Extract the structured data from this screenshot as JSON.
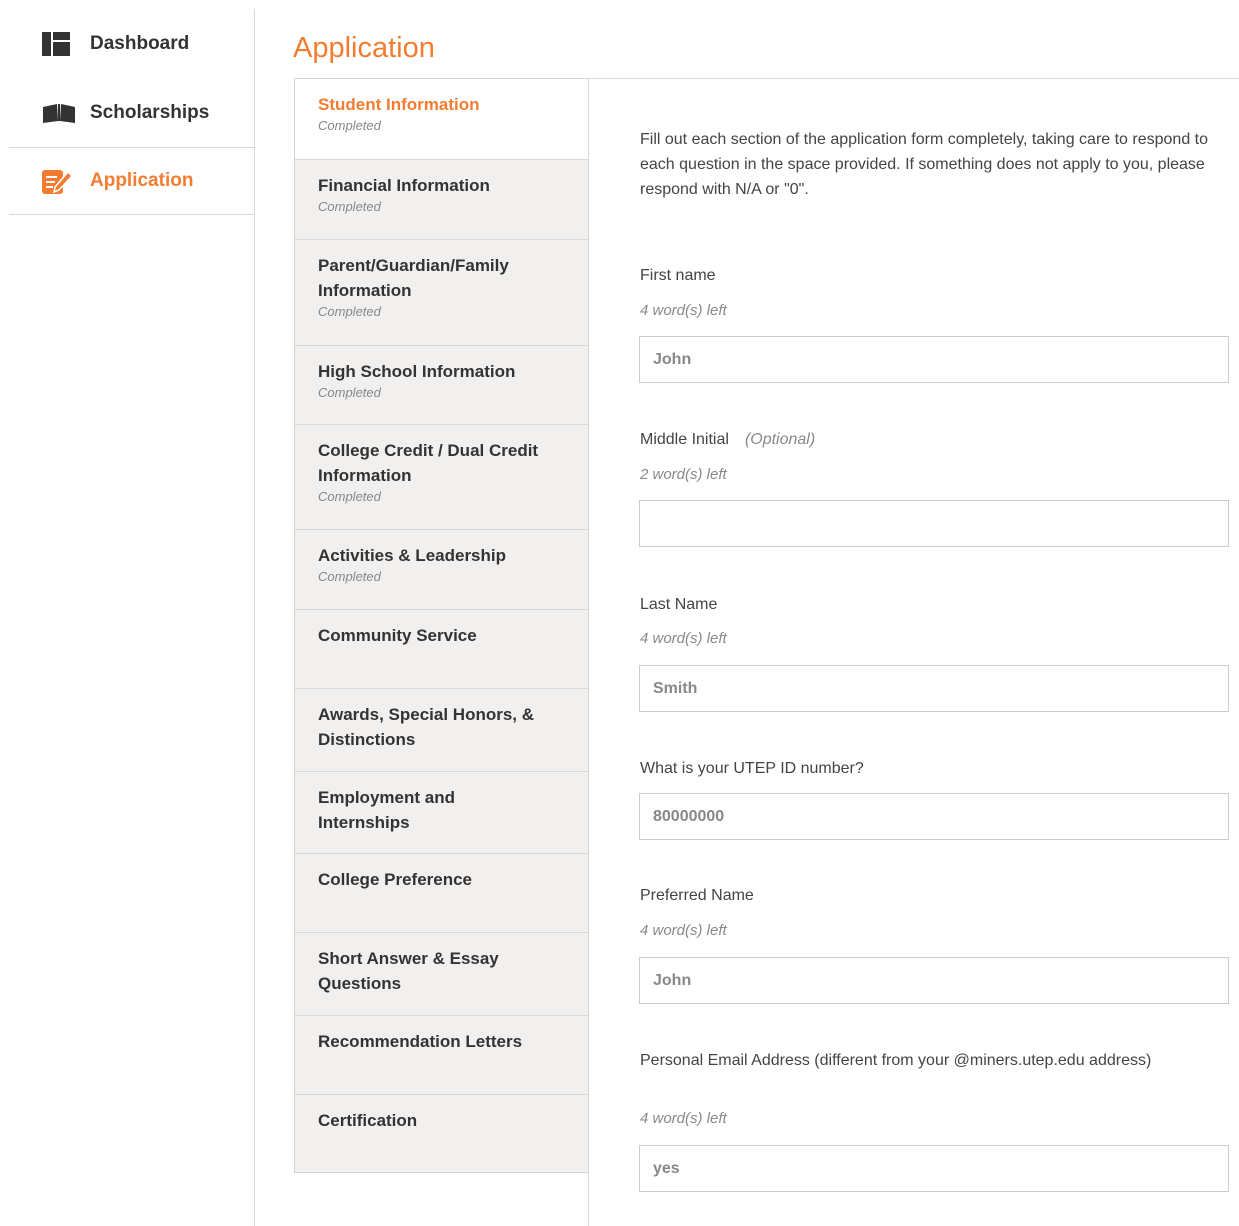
{
  "sidebar": {
    "items": [
      {
        "label": "Dashboard",
        "icon": "dashboard-icon"
      },
      {
        "label": "Scholarships",
        "icon": "open-book-icon"
      },
      {
        "label": "Application",
        "icon": "edit-pencil-icon"
      }
    ],
    "active_color": "#f47c30"
  },
  "page": {
    "title": "Application"
  },
  "sections": [
    {
      "title": "Student Information",
      "status": "Completed"
    },
    {
      "title": "Financial Information",
      "status": "Completed"
    },
    {
      "title": "Parent/Guardian/Family Information",
      "status": "Completed"
    },
    {
      "title": "High School Information",
      "status": "Completed"
    },
    {
      "title": "College Credit / Dual Credit Information",
      "status": "Completed"
    },
    {
      "title": "Activities & Leadership",
      "status": "Completed"
    },
    {
      "title": "Community Service",
      "status": ""
    },
    {
      "title": "Awards, Special Honors, & Distinctions",
      "status": ""
    },
    {
      "title": "Employment and Internships",
      "status": ""
    },
    {
      "title": "College Preference",
      "status": ""
    },
    {
      "title": "Short Answer & Essay Questions",
      "status": ""
    },
    {
      "title": "Recommendation Letters",
      "status": ""
    },
    {
      "title": "Certification",
      "status": ""
    }
  ],
  "form": {
    "intro": "Fill out each section of the application form completely, taking care to respond to each question in the space provided. If something does not apply to you, please respond with N/A or \"0\".",
    "fields": [
      {
        "label": "First name",
        "optional": "",
        "hint": "4 word(s) left",
        "value": "John"
      },
      {
        "label": "Middle Initial",
        "optional": "(Optional)",
        "hint": "2 word(s) left",
        "value": ""
      },
      {
        "label": "Last Name",
        "optional": "",
        "hint": "4 word(s) left",
        "value": "Smith"
      },
      {
        "label": "What is your UTEP ID number?",
        "optional": "",
        "hint": "",
        "value": "80000000"
      },
      {
        "label": "Preferred Name",
        "optional": "",
        "hint": "4 word(s) left",
        "value": "John"
      },
      {
        "label": "Personal Email Address (different from your @miners.utep.edu address)",
        "optional": "",
        "hint": "4 word(s) left",
        "value": "yes"
      }
    ]
  }
}
